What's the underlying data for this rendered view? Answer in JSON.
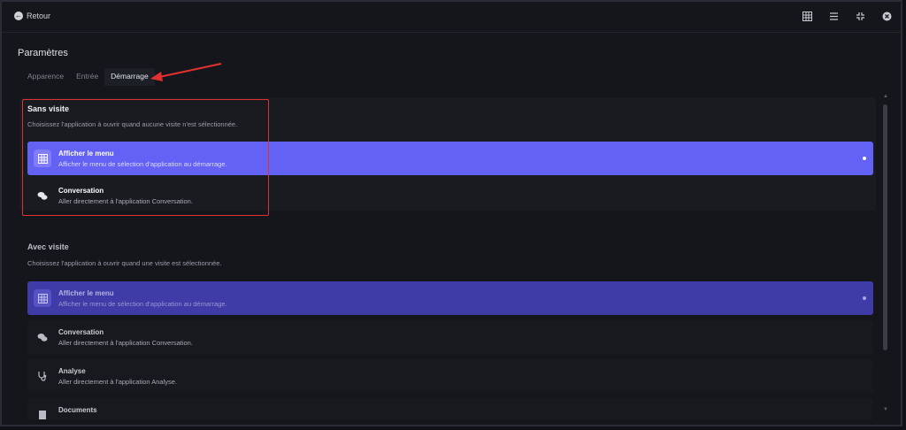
{
  "topbar": {
    "back_label": "Retour",
    "icons": [
      "grid-icon",
      "list-icon",
      "collapse-icon",
      "close-icon"
    ]
  },
  "page": {
    "title": "Paramètres",
    "tabs": [
      {
        "label": "Apparence",
        "active": false
      },
      {
        "label": "Entrée",
        "active": false
      },
      {
        "label": "Démarrage",
        "active": true
      }
    ]
  },
  "sections": {
    "sans_visite": {
      "title": "Sans visite",
      "description": "Choisissez l'application à ouvrir quand aucune visite n'est sélectionnée.",
      "options": [
        {
          "title": "Afficher le menu",
          "subtitle": "Afficher le menu de sélection d'application au démarrage.",
          "icon": "grid-icon",
          "selected": true
        },
        {
          "title": "Conversation",
          "subtitle": "Aller directement à l'application Conversation.",
          "icon": "chat-icon",
          "selected": false
        }
      ]
    },
    "avec_visite": {
      "title": "Avec visite",
      "description": "Choisissez l'application à ouvrir quand une visite est sélectionnée.",
      "options": [
        {
          "title": "Afficher le menu",
          "subtitle": "Afficher le menu de sélection d'application au démarrage.",
          "icon": "grid-icon",
          "selected": true
        },
        {
          "title": "Conversation",
          "subtitle": "Aller directement à l'application Conversation.",
          "icon": "chat-icon",
          "selected": false
        },
        {
          "title": "Analyse",
          "subtitle": "Aller directement à l'application Analyse.",
          "icon": "stethoscope-icon",
          "selected": false
        },
        {
          "title": "Documents",
          "subtitle": "",
          "icon": "document-icon",
          "selected": false
        }
      ]
    }
  },
  "colors": {
    "accent": "#6462f5",
    "accent_dim": "#3f3ca8",
    "highlight_box": "#e03131",
    "background": "#14161c"
  }
}
